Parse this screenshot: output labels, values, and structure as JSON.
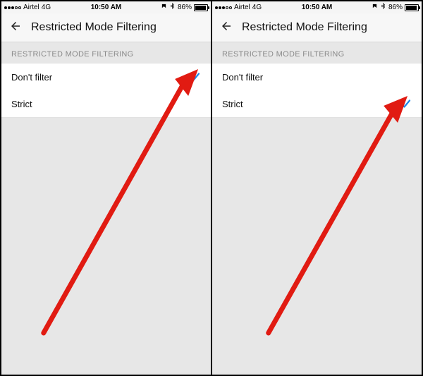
{
  "status_bar": {
    "carrier": "Airtel",
    "network": "4G",
    "time": "10:50 AM",
    "battery_pct": "86%"
  },
  "header": {
    "title": "Restricted Mode Filtering"
  },
  "section": {
    "label": "RESTRICTED MODE FILTERING",
    "options": [
      {
        "label": "Don't filter"
      },
      {
        "label": "Strict"
      }
    ]
  },
  "screens": [
    {
      "selected_index": 0
    },
    {
      "selected_index": 1
    }
  ],
  "colors": {
    "check": "#1f87e8",
    "arrow": "#e11b12"
  }
}
